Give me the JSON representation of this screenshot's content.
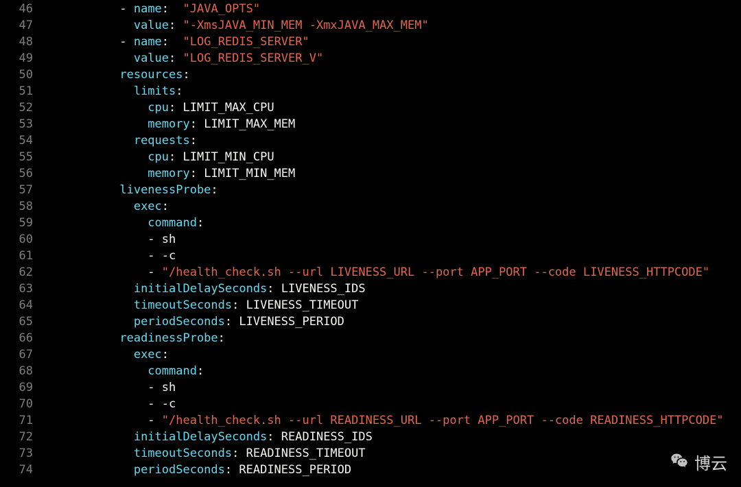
{
  "indent_unit": "  ",
  "lines": [
    {
      "num": 46,
      "indent": 5,
      "tokens": [
        {
          "t": "dash",
          "v": "- "
        },
        {
          "t": "key",
          "v": "name"
        },
        {
          "t": "colon",
          "v": ":  "
        },
        {
          "t": "str",
          "v": "\"JAVA_OPTS\""
        }
      ]
    },
    {
      "num": 47,
      "indent": 6,
      "tokens": [
        {
          "t": "key",
          "v": "value"
        },
        {
          "t": "colon",
          "v": ": "
        },
        {
          "t": "str",
          "v": "\"-XmsJAVA_MIN_MEM -XmxJAVA_MAX_MEM\""
        }
      ]
    },
    {
      "num": 48,
      "indent": 5,
      "tokens": [
        {
          "t": "dash",
          "v": "- "
        },
        {
          "t": "key",
          "v": "name"
        },
        {
          "t": "colon",
          "v": ":  "
        },
        {
          "t": "str",
          "v": "\"LOG_REDIS_SERVER\""
        }
      ]
    },
    {
      "num": 49,
      "indent": 6,
      "tokens": [
        {
          "t": "key",
          "v": "value"
        },
        {
          "t": "colon",
          "v": ": "
        },
        {
          "t": "str",
          "v": "\"LOG_REDIS_SERVER_V\""
        }
      ]
    },
    {
      "num": 50,
      "indent": 5,
      "tokens": [
        {
          "t": "key",
          "v": "resources"
        },
        {
          "t": "colon",
          "v": ":"
        }
      ]
    },
    {
      "num": 51,
      "indent": 6,
      "tokens": [
        {
          "t": "key",
          "v": "limits"
        },
        {
          "t": "colon",
          "v": ":"
        }
      ]
    },
    {
      "num": 52,
      "indent": 7,
      "tokens": [
        {
          "t": "key",
          "v": "cpu"
        },
        {
          "t": "colon",
          "v": ": "
        },
        {
          "t": "plain",
          "v": "LIMIT_MAX_CPU"
        }
      ]
    },
    {
      "num": 53,
      "indent": 7,
      "tokens": [
        {
          "t": "key",
          "v": "memory"
        },
        {
          "t": "colon",
          "v": ": "
        },
        {
          "t": "plain",
          "v": "LIMIT_MAX_MEM"
        }
      ]
    },
    {
      "num": 54,
      "indent": 6,
      "tokens": [
        {
          "t": "key",
          "v": "requests"
        },
        {
          "t": "colon",
          "v": ":"
        }
      ]
    },
    {
      "num": 55,
      "indent": 7,
      "tokens": [
        {
          "t": "key",
          "v": "cpu"
        },
        {
          "t": "colon",
          "v": ": "
        },
        {
          "t": "plain",
          "v": "LIMIT_MIN_CPU"
        }
      ]
    },
    {
      "num": 56,
      "indent": 7,
      "tokens": [
        {
          "t": "key",
          "v": "memory"
        },
        {
          "t": "colon",
          "v": ": "
        },
        {
          "t": "plain",
          "v": "LIMIT_MIN_MEM"
        }
      ]
    },
    {
      "num": 57,
      "indent": 5,
      "tokens": [
        {
          "t": "key",
          "v": "livenessProbe"
        },
        {
          "t": "colon",
          "v": ":"
        }
      ]
    },
    {
      "num": 58,
      "indent": 6,
      "tokens": [
        {
          "t": "key",
          "v": "exec"
        },
        {
          "t": "colon",
          "v": ":"
        }
      ]
    },
    {
      "num": 59,
      "indent": 7,
      "tokens": [
        {
          "t": "key",
          "v": "command"
        },
        {
          "t": "colon",
          "v": ":"
        }
      ]
    },
    {
      "num": 60,
      "indent": 7,
      "tokens": [
        {
          "t": "dash",
          "v": "- "
        },
        {
          "t": "plain",
          "v": "sh"
        }
      ]
    },
    {
      "num": 61,
      "indent": 7,
      "tokens": [
        {
          "t": "dash",
          "v": "- "
        },
        {
          "t": "plain",
          "v": "-c"
        }
      ]
    },
    {
      "num": 62,
      "indent": 7,
      "tokens": [
        {
          "t": "dash",
          "v": "- "
        },
        {
          "t": "str",
          "v": "\"/health_check.sh --url LIVENESS_URL --port APP_PORT --code LIVENESS_HTTPCODE\""
        }
      ]
    },
    {
      "num": 63,
      "indent": 6,
      "tokens": [
        {
          "t": "key",
          "v": "initialDelaySeconds"
        },
        {
          "t": "colon",
          "v": ": "
        },
        {
          "t": "plain",
          "v": "LIVENESS_IDS"
        }
      ]
    },
    {
      "num": 64,
      "indent": 6,
      "tokens": [
        {
          "t": "key",
          "v": "timeoutSeconds"
        },
        {
          "t": "colon",
          "v": ": "
        },
        {
          "t": "plain",
          "v": "LIVENESS_TIMEOUT"
        }
      ]
    },
    {
      "num": 65,
      "indent": 6,
      "tokens": [
        {
          "t": "key",
          "v": "periodSeconds"
        },
        {
          "t": "colon",
          "v": ": "
        },
        {
          "t": "plain",
          "v": "LIVENESS_PERIOD"
        }
      ]
    },
    {
      "num": 66,
      "indent": 5,
      "tokens": [
        {
          "t": "key",
          "v": "readinessProbe"
        },
        {
          "t": "colon",
          "v": ":"
        }
      ]
    },
    {
      "num": 67,
      "indent": 6,
      "tokens": [
        {
          "t": "key",
          "v": "exec"
        },
        {
          "t": "colon",
          "v": ":"
        }
      ]
    },
    {
      "num": 68,
      "indent": 7,
      "tokens": [
        {
          "t": "key",
          "v": "command"
        },
        {
          "t": "colon",
          "v": ":"
        }
      ]
    },
    {
      "num": 69,
      "indent": 7,
      "tokens": [
        {
          "t": "dash",
          "v": "- "
        },
        {
          "t": "plain",
          "v": "sh"
        }
      ]
    },
    {
      "num": 70,
      "indent": 7,
      "tokens": [
        {
          "t": "dash",
          "v": "- "
        },
        {
          "t": "plain",
          "v": "-c"
        }
      ]
    },
    {
      "num": 71,
      "indent": 7,
      "tokens": [
        {
          "t": "dash",
          "v": "- "
        },
        {
          "t": "str",
          "v": "\"/health_check.sh --url READINESS_URL --port APP_PORT --code READINESS_HTTPCODE\""
        }
      ]
    },
    {
      "num": 72,
      "indent": 6,
      "tokens": [
        {
          "t": "key",
          "v": "initialDelaySeconds"
        },
        {
          "t": "colon",
          "v": ": "
        },
        {
          "t": "plain",
          "v": "READINESS_IDS"
        }
      ]
    },
    {
      "num": 73,
      "indent": 6,
      "tokens": [
        {
          "t": "key",
          "v": "timeoutSeconds"
        },
        {
          "t": "colon",
          "v": ": "
        },
        {
          "t": "plain",
          "v": "READINESS_TIMEOUT"
        }
      ]
    },
    {
      "num": 74,
      "indent": 6,
      "tokens": [
        {
          "t": "key",
          "v": "periodSeconds"
        },
        {
          "t": "colon",
          "v": ": "
        },
        {
          "t": "plain",
          "v": "READINESS_PERIOD"
        }
      ]
    }
  ],
  "watermark": {
    "label": "博云"
  }
}
